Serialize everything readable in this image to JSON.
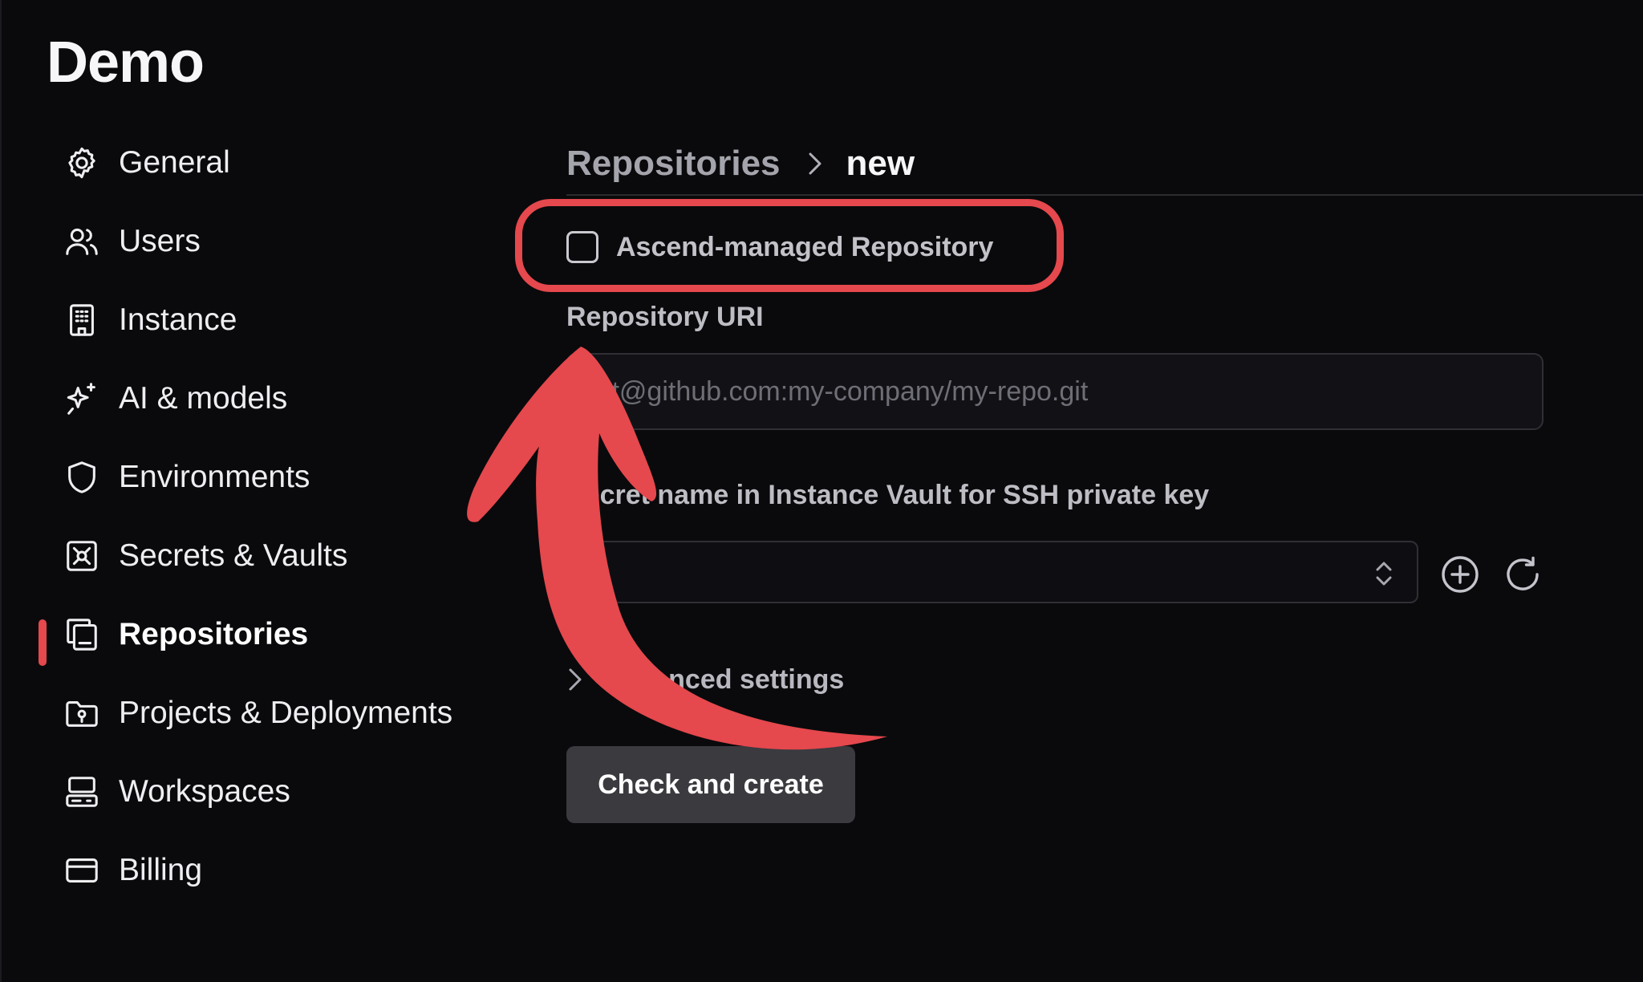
{
  "app": {
    "title": "Demo"
  },
  "sidebar": {
    "items": [
      {
        "label": "General",
        "icon": "gear-icon"
      },
      {
        "label": "Users",
        "icon": "users-icon"
      },
      {
        "label": "Instance",
        "icon": "building-icon"
      },
      {
        "label": "AI & models",
        "icon": "sparkles-icon"
      },
      {
        "label": "Environments",
        "icon": "shield-icon"
      },
      {
        "label": "Secrets & Vaults",
        "icon": "vault-icon"
      },
      {
        "label": "Repositories",
        "icon": "repositories-icon",
        "active": true
      },
      {
        "label": "Projects & Deployments",
        "icon": "folder-icon"
      },
      {
        "label": "Workspaces",
        "icon": "workspaces-icon"
      },
      {
        "label": "Billing",
        "icon": "credit-card-icon"
      }
    ]
  },
  "breadcrumb": {
    "parent": "Repositories",
    "current": "new"
  },
  "form": {
    "managed_checkbox": {
      "label": "Ascend-managed Repository",
      "checked": false
    },
    "repo_uri": {
      "label": "Repository URI",
      "placeholder": "git@github.com:my-company/my-repo.git",
      "value": ""
    },
    "secret": {
      "label": "Secret name in Instance Vault for SSH private key",
      "value": ""
    },
    "advanced_label": "Advanced settings",
    "submit_label": "Check and create"
  },
  "colors": {
    "accent": "#e5484d",
    "background": "#0a0a0c",
    "button": "#3a3a3f"
  }
}
